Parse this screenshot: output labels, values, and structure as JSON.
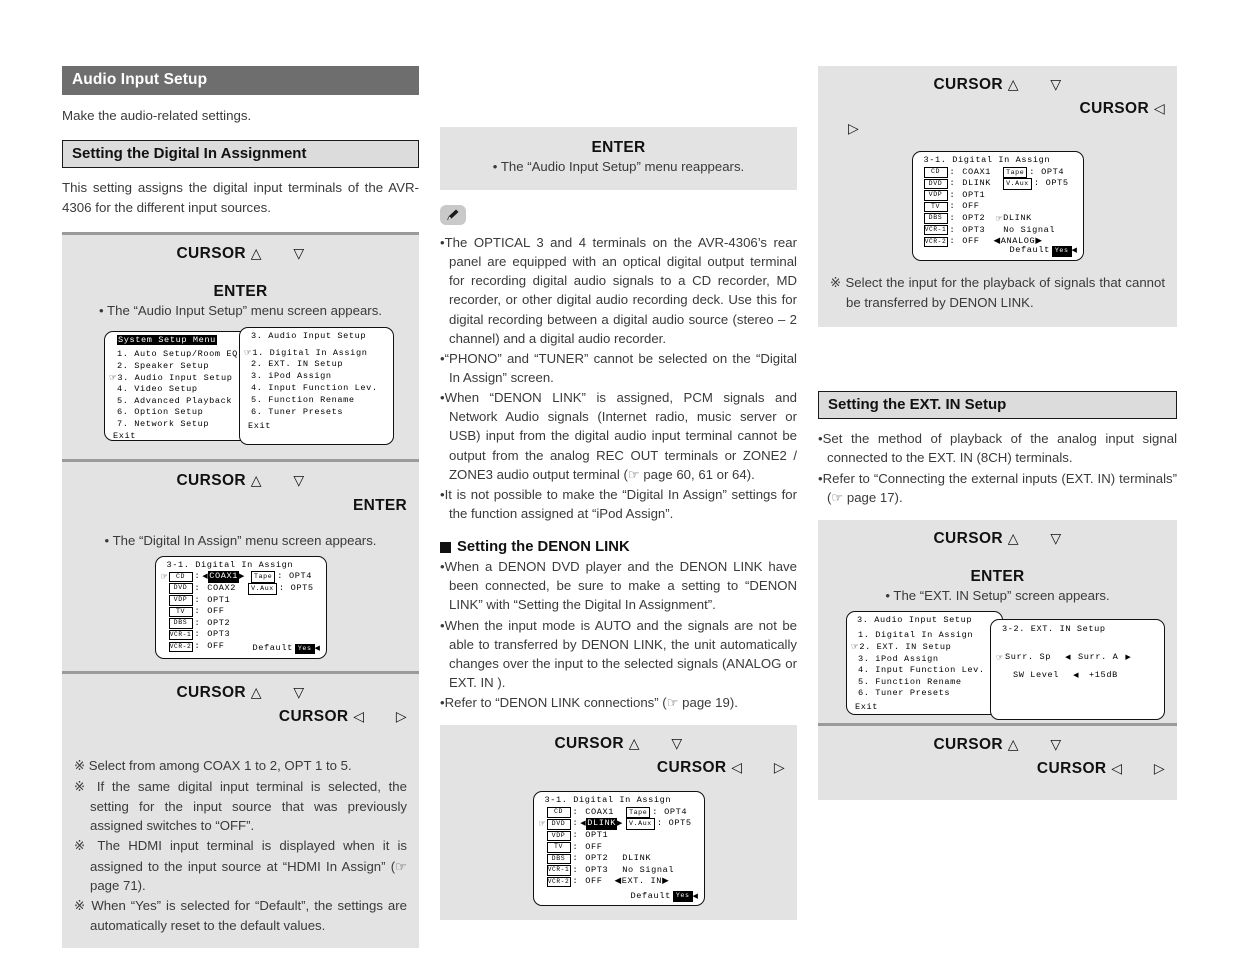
{
  "section": {
    "title": "Audio Input Setup",
    "intro": "Make the audio-related settings."
  },
  "subsection_digital": {
    "title": "Setting the Digital In Assignment",
    "intro": "This setting assigns the digital input terminals of the AVR-4306 for the different input sources."
  },
  "labels": {
    "cursor": "CURSOR",
    "enter": "ENTER",
    "up": "△",
    "down": "▽",
    "left": "◁",
    "right": "▷"
  },
  "left": {
    "step1_note": "• The “Audio Input Setup” menu screen appears.",
    "step2_note": "• The “Digital In Assign” menu screen appears.",
    "notes": [
      "Select from among COAX 1 to 2, OPT 1 to 5.",
      "If the same digital input terminal is selected, the setting for the input source that was previously assigned switches to “OFF”.",
      "The HDMI input terminal is displayed when it is assigned to the input source at “HDMI In Assign” (☞ page 71).",
      "When “Yes” is selected for “Default”, the settings are automatically reset to the default values."
    ]
  },
  "osd_system_menu": {
    "title": "System Setup Menu",
    "items": [
      "1. Auto Setup/Room EQ",
      "2. Speaker Setup",
      "3. Audio Input Setup",
      "4. Video Setup",
      "5. Advanced Playback",
      "6. Option Setup",
      "7. Network Setup"
    ],
    "cursor_index": 2,
    "exit": "Exit"
  },
  "osd_audio_input_setup": {
    "title": "3. Audio Input Setup",
    "items": [
      "1. Digital In Assign",
      "2. EXT. IN Setup",
      "3. iPod Assign",
      "4. Input Function Lev.",
      "5. Function Rename",
      "6. Tuner Presets"
    ],
    "cursor_index": 0,
    "exit": "Exit"
  },
  "osd_audio_input_setup_2": {
    "title": "3. Audio Input Setup",
    "items": [
      "1. Digital In Assign",
      "2. EXT. IN Setup",
      "3. iPod Assign",
      "4. Input Function Lev.",
      "5. Function Rename",
      "6. Tuner Presets"
    ],
    "cursor_index": 1,
    "exit": "Exit"
  },
  "osd_digital_in_1": {
    "title": "3-1. Digital In Assign",
    "left_rows": [
      {
        "tag": "CD",
        "value": "COAX1",
        "selected": true,
        "cursor": true
      },
      {
        "tag": "DVD",
        "value": "COAX2",
        "selected": false,
        "cursor": false
      },
      {
        "tag": "VDP",
        "value": "OPT1",
        "selected": false,
        "cursor": false
      },
      {
        "tag": "TV",
        "value": "OFF",
        "selected": false,
        "cursor": false
      },
      {
        "tag": "DBS",
        "value": "OPT2",
        "selected": false,
        "cursor": false
      },
      {
        "tag": "VCR-1",
        "value": "OPT3",
        "selected": false,
        "cursor": false
      },
      {
        "tag": "VCR-2",
        "value": "OFF",
        "selected": false,
        "cursor": false
      }
    ],
    "right_rows": [
      {
        "tag": "Tape",
        "value": "OPT4"
      },
      {
        "tag": "V.Aux",
        "value": "OPT5"
      }
    ],
    "extra": [],
    "default_label": "Default",
    "default_value": "Yes"
  },
  "osd_digital_in_2": {
    "title": "3-1. Digital In Assign",
    "left_rows": [
      {
        "tag": "CD",
        "value": "COAX1",
        "selected": false,
        "cursor": false
      },
      {
        "tag": "DVD",
        "value": "DLINK",
        "selected": true,
        "cursor": true
      },
      {
        "tag": "VDP",
        "value": "OPT1",
        "selected": false,
        "cursor": false
      },
      {
        "tag": "TV",
        "value": "OFF",
        "selected": false,
        "cursor": false
      },
      {
        "tag": "DBS",
        "value": "OPT2",
        "selected": false,
        "cursor": false
      },
      {
        "tag": "VCR-1",
        "value": "OPT3",
        "selected": false,
        "cursor": false
      },
      {
        "tag": "VCR-2",
        "value": "OFF",
        "selected": false,
        "cursor": false
      }
    ],
    "right_rows": [
      {
        "tag": "Tape",
        "value": "OPT4"
      },
      {
        "tag": "V.Aux",
        "value": "OPT5"
      }
    ],
    "extra": [
      {
        "text": "DLINK",
        "cursor": false,
        "arrows": false
      },
      {
        "text": "No Signal",
        "cursor": false,
        "arrows": false
      },
      {
        "text": "EXT. IN",
        "cursor": false,
        "arrows": true
      }
    ],
    "default_label": "Default",
    "default_value": "Yes"
  },
  "osd_digital_in_3": {
    "title": "3-1. Digital In Assign",
    "left_rows": [
      {
        "tag": "CD",
        "value": "COAX1",
        "selected": false,
        "cursor": false
      },
      {
        "tag": "DVD",
        "value": "DLINK",
        "selected": false,
        "cursor": false
      },
      {
        "tag": "VDP",
        "value": "OPT1",
        "selected": false,
        "cursor": false
      },
      {
        "tag": "TV",
        "value": "OFF",
        "selected": false,
        "cursor": false
      },
      {
        "tag": "DBS",
        "value": "OPT2",
        "selected": false,
        "cursor": false
      },
      {
        "tag": "VCR-1",
        "value": "OPT3",
        "selected": false,
        "cursor": false
      },
      {
        "tag": "VCR-2",
        "value": "OFF",
        "selected": false,
        "cursor": false
      }
    ],
    "right_rows": [
      {
        "tag": "Tape",
        "value": "OPT4"
      },
      {
        "tag": "V.Aux",
        "value": "OPT5"
      }
    ],
    "extra": [
      {
        "text": "DLINK",
        "cursor": true,
        "arrows": false
      },
      {
        "text": "No Signal",
        "cursor": false,
        "arrows": false
      },
      {
        "text": "ANALOG",
        "cursor": false,
        "arrows": true
      }
    ],
    "default_label": "Default",
    "default_value": "Yes"
  },
  "osd_ext_in_setup": {
    "title": "3-2. EXT. IN Setup",
    "rows": [
      {
        "label": "Surr. Sp",
        "value": "Surr. A",
        "cursor": true,
        "left_arrow": true,
        "right_arrow": true
      },
      {
        "label": "SW Level",
        "value": "+15dB",
        "cursor": false,
        "left_arrow": true,
        "right_arrow": false
      }
    ]
  },
  "middle": {
    "enter_note": "• The “Audio Input Setup” menu reappears.",
    "notes": [
      "The OPTICAL 3 and 4 terminals on the AVR-4306’s rear panel are equipped with an optical digital output terminal for recording digital audio signals to a CD recorder, MD recorder, or other digital audio recording deck. Use this for digital recording between a digital audio source (stereo – 2 channel) and a digital audio recorder.",
      "“PHONO” and “TUNER” cannot be selected on the “Digital In Assign” screen.",
      "When “DENON LINK” is assigned, PCM signals and Network Audio signals (Internet radio, music server or USB) input from the digital audio input terminal cannot be output from the analog REC OUT terminals or ZONE2 / ZONE3 audio output terminal (☞ page 60, 61 or 64).",
      "It is not possible to make the “Digital In Assign” settings for the function assigned at “iPod Assign”."
    ],
    "denon_link_heading": "Setting the DENON LINK",
    "denon_link_notes": [
      "When a DENON DVD player and the DENON LINK have been connected, be sure to make a setting to “DENON LINK” with “Setting the Digital In Assignment”.",
      "When the input mode is AUTO and the signals are not be able to transferred by DENON LINK, the unit automatically changes over the input to the selected signals (ANALOG or EXT. IN ).",
      "Refer to “DENON LINK connections” (☞ page 19)."
    ]
  },
  "right": {
    "note_after_osd": "Select the input for the playback of signals that cannot be transferred by DENON LINK.",
    "ext_in": {
      "title": "Setting the EXT. IN Setup",
      "notes": [
        "Set the method of playback of the analog input signal connected to the EXT. IN (8CH) terminals.",
        "Refer to “Connecting the external inputs (EXT. IN) terminals” (☞ page 17)."
      ],
      "enter_note": "• The “EXT. IN Setup” screen appears."
    }
  },
  "colors": {
    "section_bar": "#6e6e6e",
    "subsection_bar": "#dcdcdc",
    "panel": "#e3e3e3",
    "rule": "#9a9a9a",
    "text": "#3a3a3a"
  }
}
